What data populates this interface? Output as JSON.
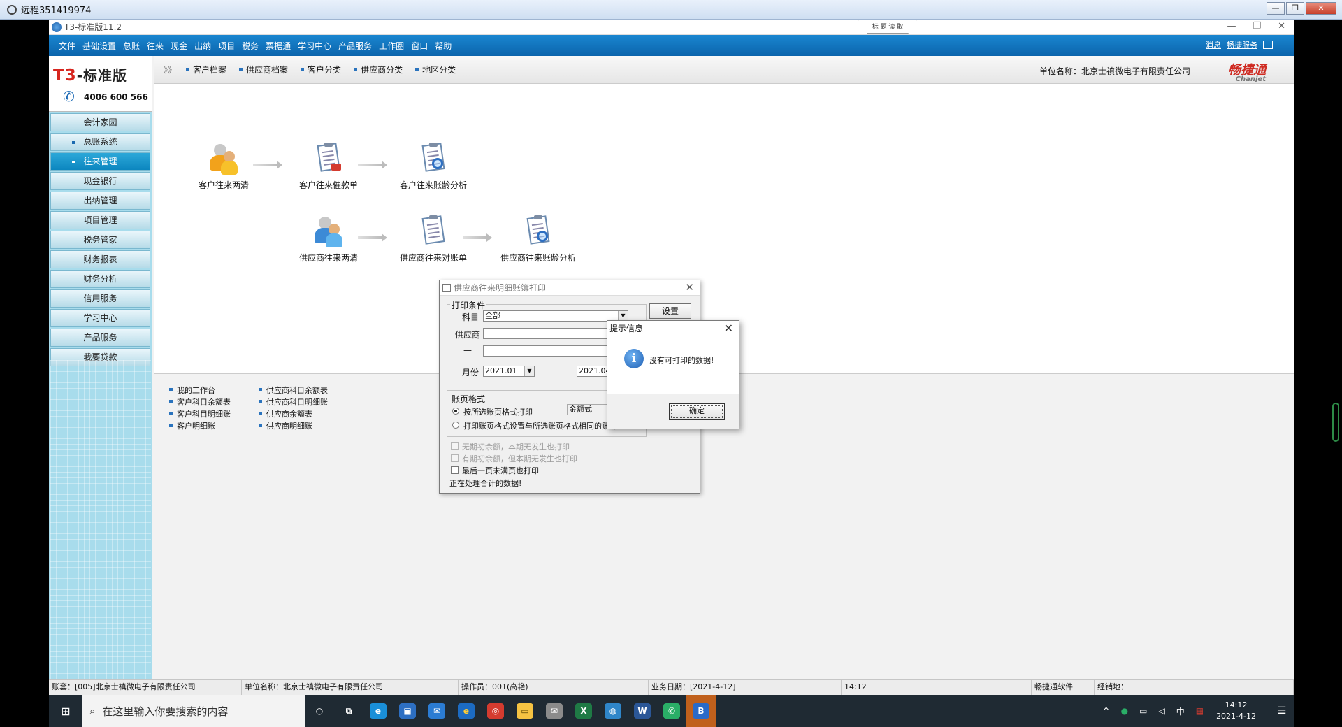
{
  "remote": {
    "title": "远程351419974",
    "controls": [
      "—",
      "❐",
      "✕"
    ]
  },
  "app": {
    "title": "T3-标准版11.2",
    "center_widget": "标 题 读 取",
    "window_controls": [
      "—",
      "❐",
      "✕"
    ],
    "menu": [
      "文件",
      "基础设置",
      "总账",
      "往来",
      "现金",
      "出纳",
      "项目",
      "税务",
      "票据通",
      "学习中心",
      "产品服务",
      "工作圈",
      "窗口",
      "帮助"
    ],
    "menu_right": {
      "messages": "消息",
      "service": "畅捷服务"
    }
  },
  "brand": {
    "name_prefix": "T3",
    "name_suffix": "-标准版",
    "phone": "4006 600 566"
  },
  "sidebar": {
    "items": [
      {
        "label": "会计家园",
        "active": false,
        "bullet": false
      },
      {
        "label": "总账系统",
        "active": false,
        "bullet": true
      },
      {
        "label": "往来管理",
        "active": true,
        "bullet": true
      },
      {
        "label": "现金银行",
        "active": false,
        "bullet": false
      },
      {
        "label": "出纳管理",
        "active": false,
        "bullet": false
      },
      {
        "label": "项目管理",
        "active": false,
        "bullet": false
      },
      {
        "label": "税务管家",
        "active": false,
        "bullet": false
      },
      {
        "label": "财务报表",
        "active": false,
        "bullet": false
      },
      {
        "label": "财务分析",
        "active": false,
        "bullet": false
      },
      {
        "label": "信用服务",
        "active": false,
        "bullet": false
      },
      {
        "label": "学习中心",
        "active": false,
        "bullet": false
      },
      {
        "label": "产品服务",
        "active": false,
        "bullet": false
      },
      {
        "label": "我要贷款",
        "active": false,
        "bullet": false
      }
    ]
  },
  "toolbar": {
    "expand": "》》",
    "buttons": [
      "客户档案",
      "供应商档案",
      "客户分类",
      "供应商分类",
      "地区分类"
    ],
    "unit": "单位名称：北京士禛微电子有限责任公司",
    "brand": "畅捷通",
    "brand_en": "Chanjet"
  },
  "flow": {
    "row1": [
      "客户往来两清",
      "客户往来催款单",
      "客户往来账龄分析"
    ],
    "row2": [
      "供应商往来两清",
      "供应商往来对账单",
      "供应商往来账龄分析"
    ]
  },
  "links": {
    "col1": [
      "我的工作台",
      "客户科目余额表",
      "客户科目明细账",
      "客户明细账"
    ],
    "col2": [
      "供应商科目余额表",
      "供应商科目明细账",
      "供应商余额表",
      "供应商明细账"
    ]
  },
  "print_dialog": {
    "title": "供应商往来明细账簿打印",
    "group_conditions": "打印条件",
    "subject_label": "科目",
    "subject_value": "全部",
    "settings_button": "设置",
    "supplier_label": "供应商",
    "dash": "—",
    "month_label": "月份",
    "month_from": "2021.01",
    "month_to": "2021.04",
    "group_format": "账页格式",
    "radio1": "按所选账页格式打印",
    "format_value": "金额式",
    "radio2": "打印账页格式设置与所选账页格式相同的账簿",
    "check1": "无期初余额，本期无发生也打印",
    "check2": "有期初余额，但本期无发生也打印",
    "check3": "最后一页未满页也打印",
    "status": "正在处理合计的数据!"
  },
  "message_box": {
    "title": "提示信息",
    "icon": "i",
    "message": "没有可打印的数据!",
    "ok": "确定"
  },
  "status_bar": {
    "account": "账套：[005]北京士禛微电子有限责任公司",
    "unit": "单位名称：北京士禛微电子有限责任公司",
    "operator": "操作员：001(高艳)",
    "business_date": "业务日期：[2021-4-12]",
    "time": "14:12",
    "vendor": "畅捷通软件",
    "dealer": "经销地："
  },
  "taskbar": {
    "search_placeholder": "在这里输入你要搜索的内容",
    "apps": [
      {
        "name": "cortana",
        "glyph": "○",
        "color": "#ffffff",
        "bg": "transparent"
      },
      {
        "name": "task-view",
        "glyph": "⧉",
        "color": "#ffffff",
        "bg": "transparent"
      },
      {
        "name": "edge",
        "glyph": "e",
        "color": "#ffffff",
        "bg": "#1a8fd8"
      },
      {
        "name": "store",
        "glyph": "▣",
        "color": "#ffffff",
        "bg": "#2d6fc2"
      },
      {
        "name": "mail",
        "glyph": "✉",
        "color": "#ffffff",
        "bg": "#2b7cd3"
      },
      {
        "name": "ie",
        "glyph": "e",
        "color": "#ffcc33",
        "bg": "#1c6bc2"
      },
      {
        "name": "app-red",
        "glyph": "◎",
        "color": "#ffffff",
        "bg": "#d43b2f"
      },
      {
        "name": "explorer",
        "glyph": "▭",
        "color": "#5a4500",
        "bg": "#f6c342"
      },
      {
        "name": "photo",
        "glyph": "✉",
        "color": "#ffffff",
        "bg": "#8b8b8b"
      },
      {
        "name": "excel",
        "glyph": "X",
        "color": "#ffffff",
        "bg": "#1f7a45"
      },
      {
        "name": "network",
        "glyph": "◍",
        "color": "#ffffff",
        "bg": "#2f86c9"
      },
      {
        "name": "word",
        "glyph": "W",
        "color": "#ffffff",
        "bg": "#2b5797"
      },
      {
        "name": "wechat",
        "glyph": "✆",
        "color": "#ffffff",
        "bg": "#2aae67"
      },
      {
        "name": "t3",
        "glyph": "B",
        "color": "#ffffff",
        "bg": "#2a6ac8"
      }
    ],
    "tray": {
      "up": "^",
      "ime": "中",
      "time": "14:12",
      "date": "2021-4-12",
      "notify": "☰"
    }
  }
}
